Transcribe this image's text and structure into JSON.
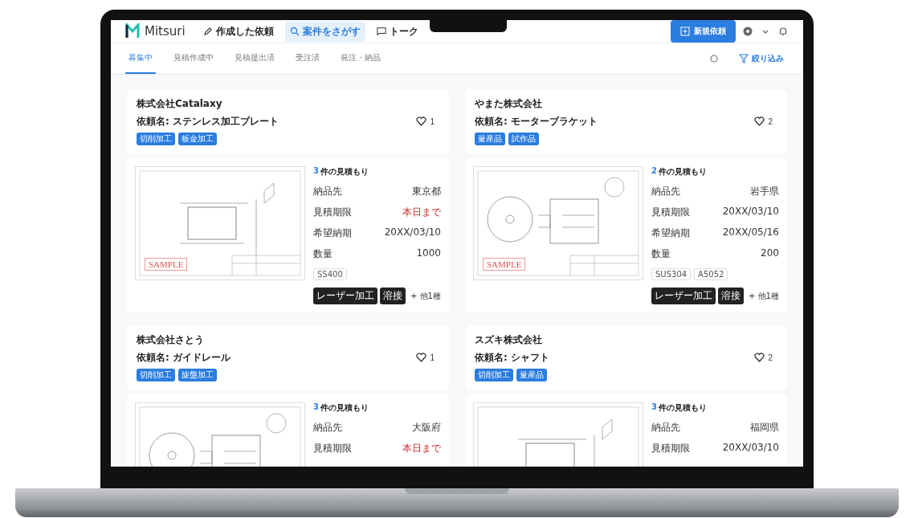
{
  "header": {
    "logo": "Mitsuri",
    "nav": [
      {
        "label": "作成した依頼",
        "selected": false
      },
      {
        "label": "案件をさがす",
        "selected": true
      },
      {
        "label": "トーク",
        "selected": false
      }
    ],
    "new_button": "新規依頼"
  },
  "tabs": [
    {
      "label": "募集中",
      "selected": true
    },
    {
      "label": "見積作成中",
      "selected": false
    },
    {
      "label": "見積提出済",
      "selected": false
    },
    {
      "label": "受注済",
      "selected": false
    },
    {
      "label": "発注・納品",
      "selected": false
    }
  ],
  "filter_button": "絞り込み",
  "cards": [
    {
      "company": "株式会社Catalaxy",
      "request": "依頼名: ステンレス加工プレート",
      "tags": [
        "切削加工",
        "板金加工"
      ],
      "likes": "1",
      "quote_count": "3",
      "quote_label": "件の見積もり",
      "stamp": "SAMPLE",
      "fields": [
        {
          "label": "納品先",
          "value": "東京都",
          "kind": "normal"
        },
        {
          "label": "見積期限",
          "value": "本日まで",
          "kind": "alert"
        },
        {
          "label": "希望納期",
          "value": "20XX/03/10",
          "kind": "normal"
        },
        {
          "label": "数量",
          "value": "1000",
          "kind": "normal"
        }
      ],
      "materials": [
        "SS400"
      ],
      "processes": [
        "レーザー加工",
        "溶接"
      ],
      "more": "+ 他1種"
    },
    {
      "company": "やまた株式会社",
      "request": "依頼名: モーターブラケット",
      "tags": [
        "量産品",
        "試作品"
      ],
      "likes": "2",
      "quote_count": "2",
      "quote_label": "件の見積もり",
      "stamp": "SAMPLE",
      "fields": [
        {
          "label": "納品先",
          "value": "岩手県",
          "kind": "normal"
        },
        {
          "label": "見積期限",
          "value": "20XX/03/10",
          "kind": "normal"
        },
        {
          "label": "希望納期",
          "value": "20XX/05/16",
          "kind": "normal"
        },
        {
          "label": "数量",
          "value": "200",
          "kind": "normal"
        }
      ],
      "materials": [
        "SUS304",
        "A5052"
      ],
      "processes": [
        "レーザー加工",
        "溶接"
      ],
      "more": "+ 他1種"
    },
    {
      "company": "株式会社さとう",
      "request": "依頼名: ガイドレール",
      "tags": [
        "切削加工",
        "旋盤加工"
      ],
      "likes": "1",
      "quote_count": "3",
      "quote_label": "件の見積もり",
      "fields": [
        {
          "label": "納品先",
          "value": "大阪府",
          "kind": "normal"
        },
        {
          "label": "見積期限",
          "value": "本日まで",
          "kind": "alert"
        }
      ]
    },
    {
      "company": "スズキ株式会社",
      "request": "依頼名: シャフト",
      "tags": [
        "切削加工",
        "量産品"
      ],
      "likes": "2",
      "quote_count": "3",
      "quote_label": "件の見積もり",
      "fields": [
        {
          "label": "納品先",
          "value": "福岡県",
          "kind": "normal"
        },
        {
          "label": "見積期限",
          "value": "20XX/03/10",
          "kind": "normal"
        }
      ]
    }
  ]
}
